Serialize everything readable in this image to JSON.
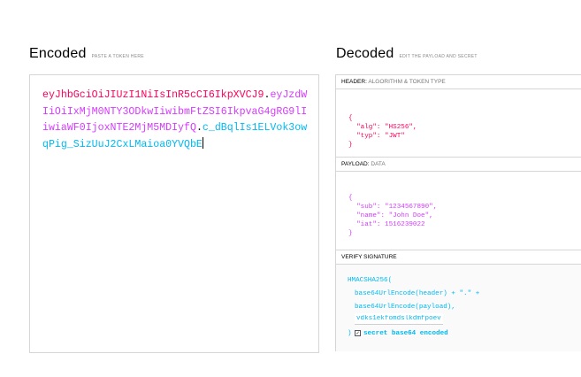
{
  "encoded": {
    "title": "Encoded",
    "hint": "PASTE A TOKEN HERE",
    "token_header": "eyJhbGciOiJIUzI1NiIsInR5cCI6IkpXVCJ9",
    "token_payload": "eyJzdWIiOiIxMjM0NTY3ODkwIiwibmFtZSI6IkpvaG4gRG9lIiwiaWF0IjoxNTE2MjM5MDIyfQ",
    "token_signature": "c_dBqlIs1ELVok3owqPig_SizUuJ2CxLMaioa0YVQbE",
    "dot": "."
  },
  "decoded": {
    "title": "Decoded",
    "hint": "EDIT THE PAYLOAD AND SECRET",
    "header_panel": {
      "title": "HEADER:",
      "subtitle": "ALGORITHM & TOKEN TYPE",
      "open": "{",
      "close": "}",
      "alg_key": "\"alg\":",
      "alg_val": "\"HS256\",",
      "typ_key": "\"typ\":",
      "typ_val": "\"JWT\""
    },
    "payload_panel": {
      "title": "PAYLOAD:",
      "subtitle": "DATA",
      "open": "{",
      "close": "}",
      "sub_key": "\"sub\":",
      "sub_val": "\"1234567890\",",
      "name_key": "\"name\":",
      "name_val": "\"John Doe\",",
      "iat_key": "\"iat\":",
      "iat_val": "1516239022"
    },
    "verify_panel": {
      "title": "VERIFY SIGNATURE",
      "line1": "HMACSHA256(",
      "line2": "base64UrlEncode(header) + \".\" +",
      "line3": "base64UrlEncode(payload),",
      "secret_value": "vdks1ekfomdslkdmfpoev",
      "close": ")",
      "checkbox_label": "secret base64 encoded",
      "checkbox_checked": true
    }
  }
}
